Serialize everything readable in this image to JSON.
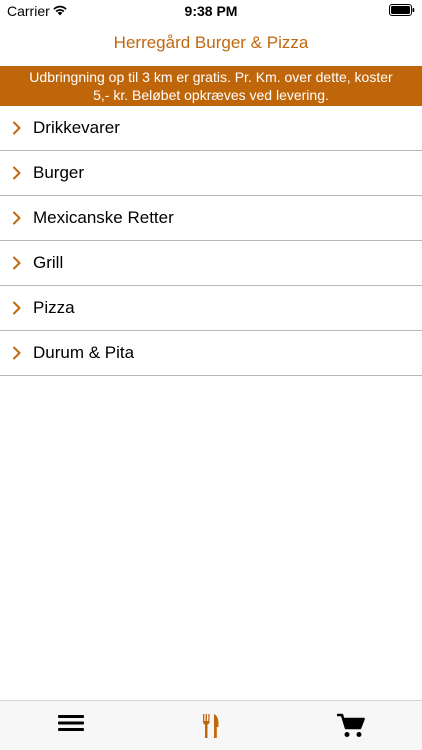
{
  "status_bar": {
    "carrier": "Carrier",
    "time": "9:38 PM",
    "wifi_icon": "wifi-icon",
    "battery_icon": "battery-icon"
  },
  "nav": {
    "title": "Herregård Burger & Pizza"
  },
  "banner": {
    "line1": "Udbringning op til 3 km er gratis. Pr. Km. over dette, koster",
    "line2": "5,- kr. Beløbet opkræves ved levering."
  },
  "menu": {
    "items": [
      {
        "label": "Drikkevarer"
      },
      {
        "label": "Burger"
      },
      {
        "label": "Mexicanske Retter"
      },
      {
        "label": "Grill"
      },
      {
        "label": "Pizza"
      },
      {
        "label": "Durum & Pita"
      }
    ]
  },
  "tab_bar": {
    "tabs": [
      {
        "icon": "hamburger-menu-icon",
        "selected": false
      },
      {
        "icon": "fork-knife-icon",
        "selected": true
      },
      {
        "icon": "cart-icon",
        "selected": false
      }
    ]
  },
  "colors": {
    "accent": "#c0680e",
    "banner_bg": "#c0660a",
    "divider": "#b8b8b8"
  }
}
